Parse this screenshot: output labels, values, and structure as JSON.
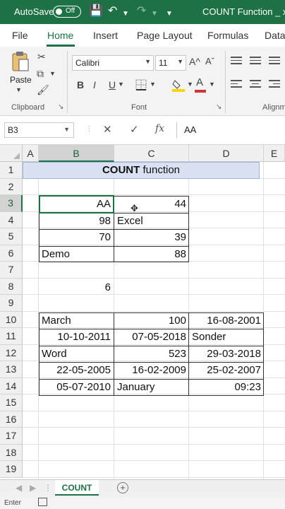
{
  "titlebar": {
    "autosave_label": "AutoSave",
    "autosave_state": "Off",
    "document_title": "COUNT Function _ xlnt"
  },
  "ribbon_tabs": [
    "File",
    "Home",
    "Insert",
    "Page Layout",
    "Formulas",
    "Data"
  ],
  "ribbon": {
    "paste_label": "Paste",
    "clipboard_label": "Clipboard",
    "font_name": "Calibri",
    "font_size": "11",
    "font_label": "Font",
    "alignment_label": "Alignm",
    "bold": "B",
    "italic": "I",
    "underline": "U",
    "grow_font": "A^",
    "shrink_font": "Aˇ",
    "font_color": "A",
    "accent_color": "#1e7145",
    "font_color_bar": "#d13438",
    "fill_color_bar": "#ffd400"
  },
  "formula_bar": {
    "name_box": "B3",
    "fx": "fx",
    "content": "AA"
  },
  "columns": [
    "A",
    "B",
    "C",
    "D",
    "E"
  ],
  "rows": [
    "1",
    "2",
    "3",
    "4",
    "5",
    "6",
    "7",
    "8",
    "9",
    "10",
    "11",
    "12",
    "13",
    "14",
    "15",
    "16",
    "17",
    "18",
    "19"
  ],
  "sheet": {
    "title_bold": "COUNT",
    "title_rest": " function",
    "cells": {
      "B3": "AA",
      "C3": "44",
      "B4": "98",
      "C4": "Excel",
      "B5": "70",
      "C5": "39",
      "B6": "Demo",
      "C6": "88",
      "B8": "6",
      "B10": "March",
      "C10": "100",
      "D10": "16-08-2001",
      "B11": "10-10-2011",
      "C11": "07-05-2018",
      "D11": "Sonder",
      "B12": "Word",
      "C12": "523",
      "D12": "29-03-2018",
      "B13": "22-05-2005",
      "C13": "16-02-2009",
      "D13": "25-02-2007",
      "B14": "05-07-2010",
      "C14": "January",
      "D14": "09:23"
    }
  },
  "sheet_tabs": {
    "active": "COUNT",
    "add_symbol": "+"
  },
  "status": {
    "mode": "Enter"
  }
}
